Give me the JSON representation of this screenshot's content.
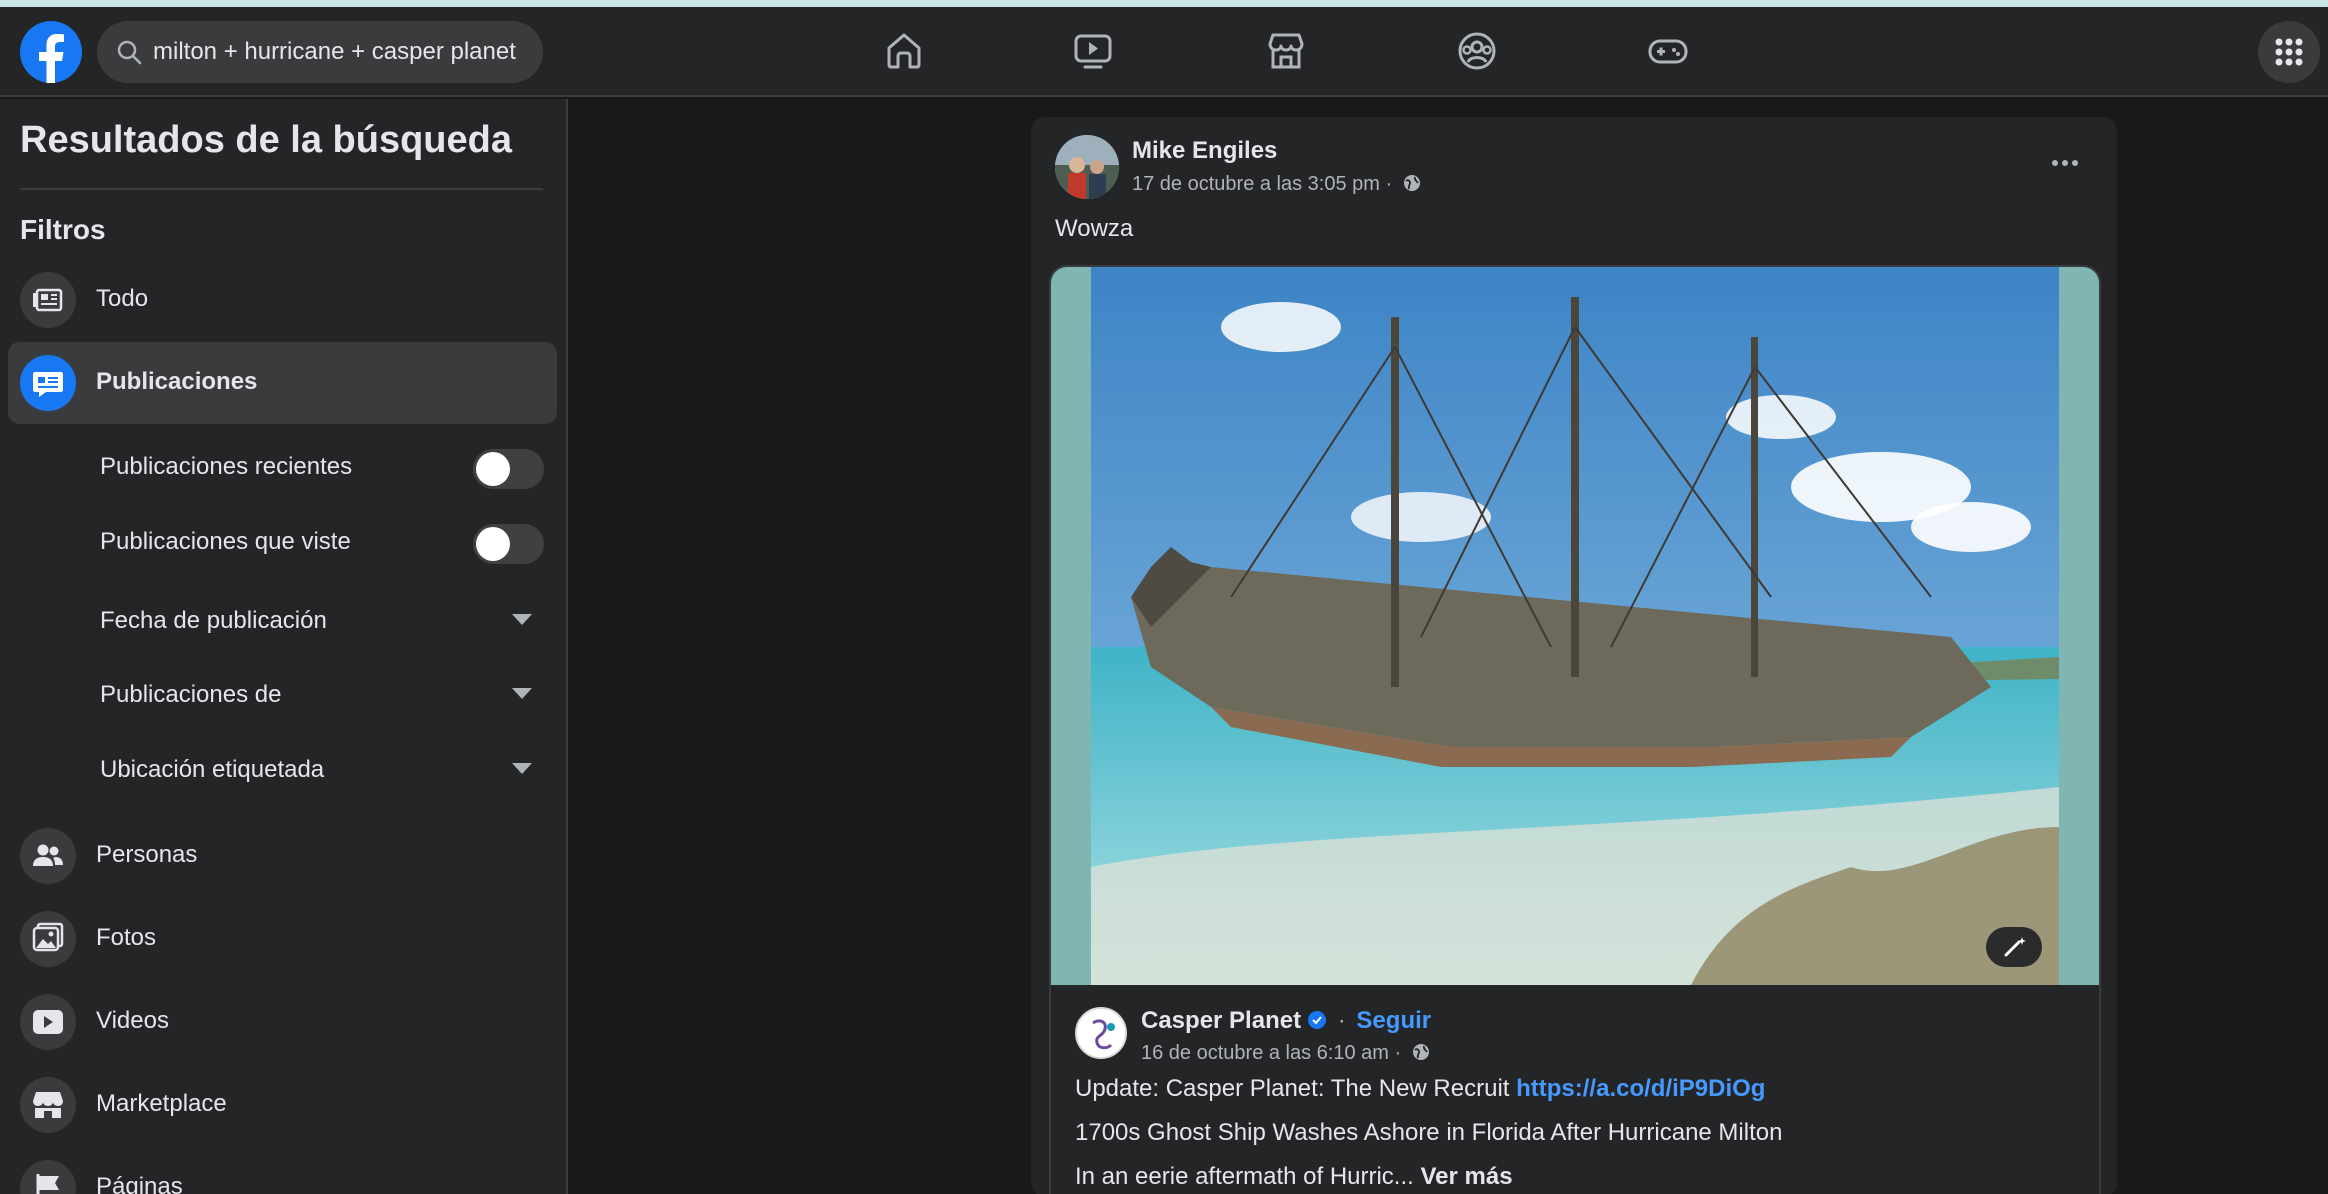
{
  "search": {
    "value": "milton + hurricane + casper planet"
  },
  "sidebar": {
    "title": "Resultados de la búsqueda",
    "filters_heading": "Filtros",
    "items": [
      {
        "label": "Todo",
        "icon": "all-results-icon"
      },
      {
        "label": "Publicaciones",
        "icon": "posts-icon",
        "active": true
      },
      {
        "label": "Personas",
        "icon": "people-icon"
      },
      {
        "label": "Fotos",
        "icon": "photos-icon"
      },
      {
        "label": "Videos",
        "icon": "video-icon"
      },
      {
        "label": "Marketplace",
        "icon": "marketplace-icon"
      },
      {
        "label": "Páginas",
        "icon": "pages-flag-icon"
      }
    ],
    "sub_filters": {
      "recent_posts": {
        "label": "Publicaciones recientes",
        "on": false
      },
      "seen_posts": {
        "label": "Publicaciones que viste",
        "on": false
      },
      "date": {
        "label": "Fecha de publicación"
      },
      "posts_from": {
        "label": "Publicaciones de"
      },
      "tagged_location": {
        "label": "Ubicación etiquetada"
      }
    }
  },
  "colors": {
    "accent": "#1877f2",
    "link": "#4599ff",
    "bg": "#18191a",
    "surface": "#242526"
  },
  "post": {
    "author": "Mike Engiles",
    "timestamp": "17 de octubre a las 3:05 pm ·",
    "text": "Wowza",
    "shared": {
      "page_name": "Casper Planet",
      "separator": "·",
      "follow_label": "Seguir",
      "timestamp": "16 de octubre a las 6:10 am ·",
      "update_prefix": "Update: Casper Planet: The New Recruit",
      "link": "https://a.co/d/iP9DiOg",
      "headline": "1700s Ghost Ship Washes Ashore in Florida After Hurricane Milton",
      "excerpt": "In an eerie aftermath of Hurric...",
      "see_more": "Ver más"
    }
  }
}
